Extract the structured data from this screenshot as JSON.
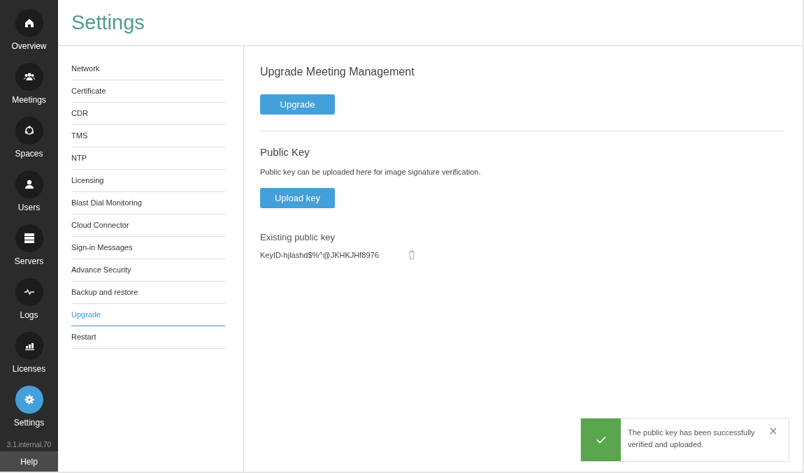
{
  "nav": [
    {
      "kind": "home",
      "label": "Overview",
      "selected": false
    },
    {
      "kind": "people",
      "label": "Meetings",
      "selected": false
    },
    {
      "kind": "spaces",
      "label": "Spaces",
      "selected": false
    },
    {
      "kind": "user",
      "label": "Users",
      "selected": false
    },
    {
      "kind": "servers",
      "label": "Servers",
      "selected": false
    },
    {
      "kind": "logs",
      "label": "Logs",
      "selected": false
    },
    {
      "kind": "licenses",
      "label": "Licenses",
      "selected": false
    },
    {
      "kind": "gear",
      "label": "Settings",
      "selected": true
    }
  ],
  "version": "3.1.internal.70",
  "help": "Help",
  "page_title": "Settings",
  "settings_menu": [
    {
      "label": "Network",
      "selected": false
    },
    {
      "label": "Certificate",
      "selected": false
    },
    {
      "label": "CDR",
      "selected": false
    },
    {
      "label": "TMS",
      "selected": false
    },
    {
      "label": "NTP",
      "selected": false
    },
    {
      "label": "Licensing",
      "selected": false
    },
    {
      "label": "Blast Dial Monitoring",
      "selected": false
    },
    {
      "label": "Cloud Connector",
      "selected": false
    },
    {
      "label": "Sign-in Messages",
      "selected": false
    },
    {
      "label": "Advance Security",
      "selected": false
    },
    {
      "label": "Backup and restore",
      "selected": false
    },
    {
      "label": "Upgrade",
      "selected": true
    },
    {
      "label": "Restart",
      "selected": false
    }
  ],
  "upgrade": {
    "heading": "Upgrade Meeting Management",
    "button": "Upgrade"
  },
  "public_key": {
    "heading": "Public Key",
    "description": "Public key can be uploaded here for image signature verification.",
    "button": "Upload key",
    "existing_label": "Existing public key",
    "key_id": "KeyID-hjlashd$%^@JKHKJHf8976"
  },
  "toast": {
    "kind": "success",
    "message": "The public key has been successfully verified and uploaded."
  }
}
